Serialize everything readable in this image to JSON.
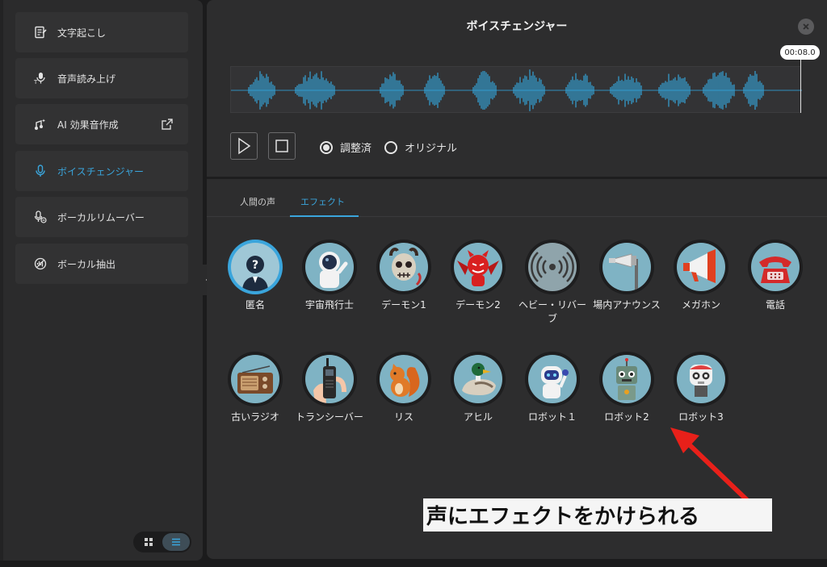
{
  "sidebar": {
    "items": [
      {
        "label": "文字起こし",
        "icon": "transcript-icon",
        "active": false
      },
      {
        "label": "音声読み上げ",
        "icon": "text-to-speech-icon",
        "active": false
      },
      {
        "label": "AI 効果音作成",
        "icon": "ai-sound-effect-icon",
        "active": false,
        "external": true
      },
      {
        "label": "ボイスチェンジャー",
        "icon": "microphone-icon",
        "active": true
      },
      {
        "label": "ボーカルリムーバー",
        "icon": "vocal-remover-icon",
        "active": false
      },
      {
        "label": "ボーカル抽出",
        "icon": "vocal-extract-icon",
        "active": false
      }
    ],
    "view_modes": [
      "grid-view-icon",
      "list-view-icon"
    ],
    "view_selected": "list"
  },
  "panel": {
    "title": "ボイスチェンジャー",
    "time": "00:08.0",
    "playback": {
      "play_icon": "play-icon",
      "stop_icon": "stop-icon"
    },
    "radio": [
      {
        "label": "調整済",
        "selected": true
      },
      {
        "label": "オリジナル",
        "selected": false
      }
    ],
    "tabs": [
      {
        "label": "人間の声",
        "active": false
      },
      {
        "label": "エフェクト",
        "active": true
      }
    ],
    "effects_row1": [
      {
        "label": "匿名",
        "icon": "anonymous-icon",
        "selected": true
      },
      {
        "label": "宇宙飛行士",
        "icon": "astronaut-icon"
      },
      {
        "label": "デーモン1",
        "icon": "skull-demon-icon"
      },
      {
        "label": "デーモン2",
        "icon": "red-demon-icon"
      },
      {
        "label": "ヘビー・リバーブ",
        "icon": "reverb-waves-icon"
      },
      {
        "label": "場内アナウンス",
        "icon": "loudspeaker-icon"
      },
      {
        "label": "メガホン",
        "icon": "megaphone-icon"
      },
      {
        "label": "電話",
        "icon": "telephone-icon"
      }
    ],
    "effects_row2": [
      {
        "label": "古いラジオ",
        "icon": "old-radio-icon"
      },
      {
        "label": "トランシーバー",
        "icon": "walkie-talkie-icon"
      },
      {
        "label": "リス",
        "icon": "squirrel-icon"
      },
      {
        "label": "アヒル",
        "icon": "duck-icon"
      },
      {
        "label": "ロボット１",
        "icon": "robot-1-icon"
      },
      {
        "label": "ロボット2",
        "icon": "robot-2-icon"
      },
      {
        "label": "ロボット3",
        "icon": "robot-3-icon"
      }
    ]
  },
  "annotation": {
    "text": "声にエフェクトをかけられる",
    "arrow_color": "#e8201a"
  },
  "colors": {
    "accent": "#3aa5dc",
    "panel": "#2d2d2e",
    "sidebar": "#2b2b2c"
  }
}
